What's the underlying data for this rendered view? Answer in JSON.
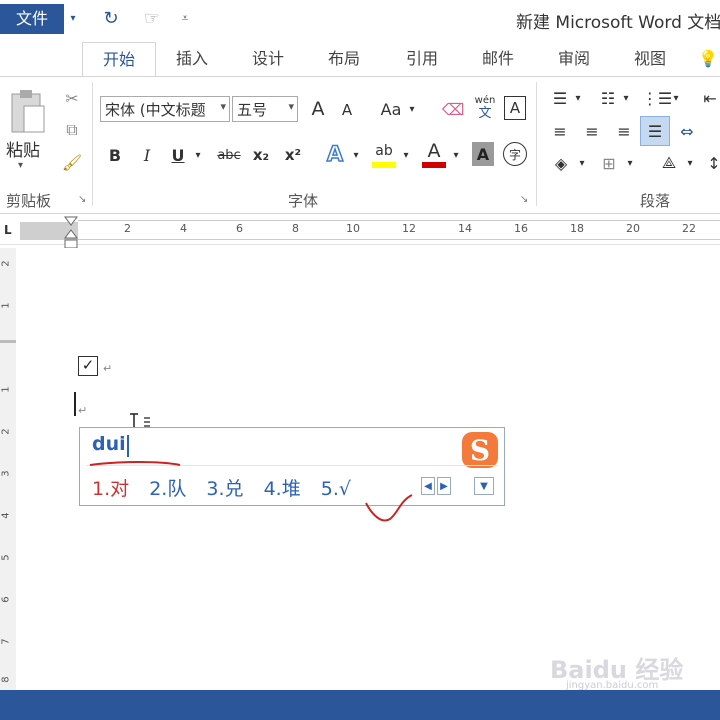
{
  "window": {
    "title": "新建 Microsoft Word 文档"
  },
  "tabs": [
    "文件",
    "开始",
    "插入",
    "设计",
    "布局",
    "引用",
    "邮件",
    "审阅",
    "视图"
  ],
  "ribbon": {
    "clipboard": {
      "paste_label": "粘贴",
      "group_label": "剪贴板"
    },
    "font": {
      "font_name": "宋体 (中文标题",
      "font_size": "五号",
      "group_label": "字体",
      "grow": "A",
      "shrink": "A",
      "change_case": "Aa",
      "bold": "B",
      "italic": "I",
      "underline": "U",
      "strike": "abc",
      "subscript": "x₂",
      "superscript": "x²",
      "phonetic_top": "wén",
      "phonetic_bottom": "文",
      "border_char": "A",
      "text_effect": "A",
      "highlight": "ab",
      "font_color": "A",
      "shading": "A",
      "enclose": "字"
    },
    "paragraph": {
      "group_label": "段落"
    }
  },
  "ruler": {
    "h_ticks": [
      "2",
      "4",
      "6",
      "8",
      "10",
      "12",
      "14",
      "16",
      "18",
      "20",
      "22"
    ],
    "v_ticks": [
      "2",
      "1",
      "1",
      "2",
      "3",
      "4",
      "5",
      "6",
      "7",
      "8"
    ]
  },
  "document": {
    "checkbox_char": "☑",
    "para_mark": "↵"
  },
  "ime": {
    "input": "dui",
    "candidates": [
      "1.对",
      "2.队",
      "3.兑",
      "4.堆",
      "5.√"
    ],
    "logo": "S"
  },
  "watermark": {
    "main": "Baidu 经验",
    "sub": "jingyan.baidu.com"
  },
  "colors": {
    "accent": "#2b579a",
    "ime_blue": "#2b62b7",
    "ime_red": "#cc3333",
    "logo_orange": "#f06a2c"
  }
}
